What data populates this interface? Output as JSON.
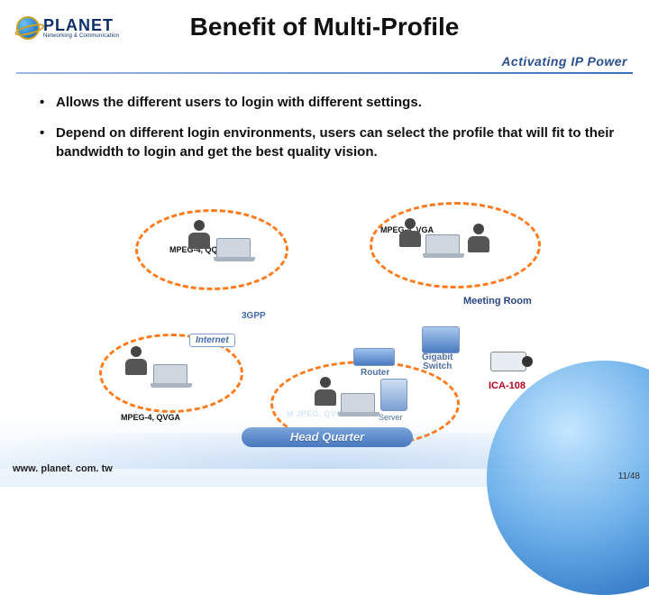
{
  "brand": {
    "name": "PLANET",
    "tagline": "Networking & Communication"
  },
  "slogan": "Activating IP Power",
  "title": "Benefit of Multi-Profile",
  "bullets": [
    "Allows the different users to login with different settings.",
    "Depend on different login environments, users can select the profile that will fit to their bandwidth to login and get the best quality vision."
  ],
  "diagram": {
    "labels": {
      "qqvga": "MPEG-4, QQVGA",
      "vga": "MPEG-4, VGA",
      "qvga": "MPEG-4, QVGA",
      "threegpp": "3GPP",
      "internet": "Internet",
      "router": "Router",
      "gigabit": "Gigabit\nSwitch",
      "meeting": "Meeting Room",
      "ica": "ICA-108",
      "mjpeg": "M JPEG, QVGA",
      "server": "Server",
      "headquarter": "Head Quarter"
    }
  },
  "footer": {
    "url": "www. planet. com. tw",
    "page": "11/48"
  }
}
